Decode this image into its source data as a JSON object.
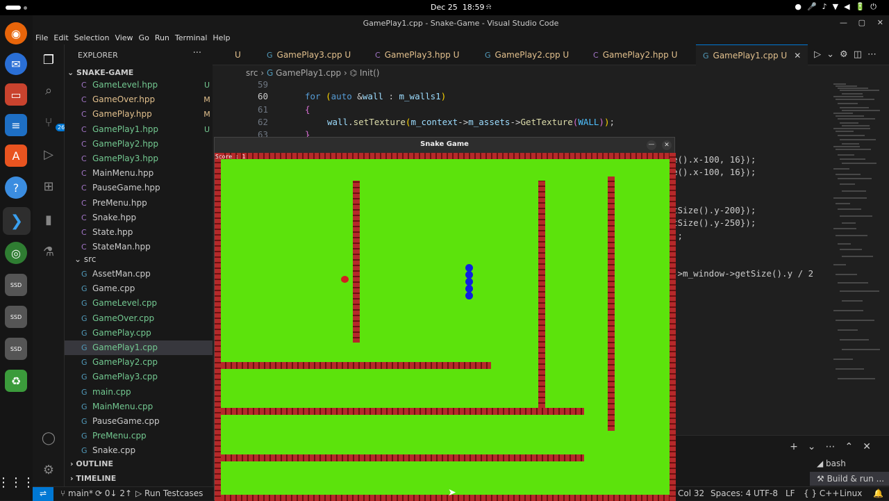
{
  "os": {
    "date": "Dec 25",
    "time": "18:59"
  },
  "window": {
    "title": "GamePlay1.cpp - Snake-Game - Visual Studio Code"
  },
  "menu": [
    "File",
    "Edit",
    "Selection",
    "View",
    "Go",
    "Run",
    "Terminal",
    "Help"
  ],
  "activity": {
    "scm_badge": "26"
  },
  "sidebar": {
    "header": "EXPLORER",
    "more": "···",
    "project": "SNAKE-GAME",
    "folder_src": "src",
    "outline": "OUTLINE",
    "timeline": "TIMELINE",
    "headers": [
      {
        "name": "GameLevel.hpp",
        "status": "U",
        "color": "#73c991"
      },
      {
        "name": "GameOver.hpp",
        "status": "M",
        "color": "#e2c08d"
      },
      {
        "name": "GamePlay.hpp",
        "status": "M",
        "color": "#e2c08d"
      },
      {
        "name": "GamePlay1.hpp",
        "status": "U",
        "color": "#73c991"
      },
      {
        "name": "GamePlay2.hpp",
        "status": "",
        "color": "#73c991"
      },
      {
        "name": "GamePlay3.hpp",
        "status": "",
        "color": "#73c991"
      },
      {
        "name": "MainMenu.hpp",
        "status": "",
        "color": "#cccccc"
      },
      {
        "name": "PauseGame.hpp",
        "status": "",
        "color": "#cccccc"
      },
      {
        "name": "PreMenu.hpp",
        "status": "",
        "color": "#cccccc"
      },
      {
        "name": "Snake.hpp",
        "status": "",
        "color": "#cccccc"
      },
      {
        "name": "State.hpp",
        "status": "",
        "color": "#cccccc"
      },
      {
        "name": "StateMan.hpp",
        "status": "",
        "color": "#cccccc"
      }
    ],
    "sources": [
      {
        "name": "AssetMan.cpp",
        "color": "#cccccc"
      },
      {
        "name": "Game.cpp",
        "color": "#cccccc"
      },
      {
        "name": "GameLevel.cpp",
        "color": "#73c991"
      },
      {
        "name": "GameOver.cpp",
        "color": "#73c991"
      },
      {
        "name": "GamePlay.cpp",
        "color": "#73c991"
      },
      {
        "name": "GamePlay1.cpp",
        "color": "#73c991"
      },
      {
        "name": "GamePlay2.cpp",
        "color": "#73c991"
      },
      {
        "name": "GamePlay3.cpp",
        "color": "#73c991"
      },
      {
        "name": "main.cpp",
        "color": "#73c991"
      },
      {
        "name": "MainMenu.cpp",
        "color": "#73c991"
      },
      {
        "name": "PauseGame.cpp",
        "color": "#cccccc"
      },
      {
        "name": "PreMenu.cpp",
        "color": "#73c991"
      },
      {
        "name": "Snake.cpp",
        "color": "#cccccc"
      }
    ]
  },
  "tabs": [
    {
      "label": "GamePlay3.cpp",
      "status": "U"
    },
    {
      "label": "GamePlay3.hpp",
      "status": "U"
    },
    {
      "label": "GamePlay2.cpp",
      "status": "U"
    },
    {
      "label": "GamePlay2.hpp",
      "status": "U"
    },
    {
      "label": "GamePlay1.cpp",
      "status": "U"
    }
  ],
  "tab_partial": "U",
  "breadcrumb": {
    "folder": "src",
    "file": "GamePlay1.cpp",
    "symbol": "Init()"
  },
  "editor": {
    "line_numbers": [
      "59",
      "60",
      "61",
      "62",
      "63"
    ],
    "right_fragments": [
      "e().x-100, 16});",
      "e().x-100, 16});",
      "tSize().y-200});",
      "tSize().y-250});",
      ");",
      "->m_window->getSize().y / 2"
    ]
  },
  "game": {
    "title": "Snake Game",
    "score_label": "Score : 1"
  },
  "terminal": {
    "bash": "bash",
    "build": "Build & run ..."
  },
  "status": {
    "branch": "main*",
    "sync": "0↓ 2↑",
    "run": "Run Testcases",
    "position": "Col 32",
    "spaces": "Spaces: 4",
    "encoding": "UTF-8",
    "eol": "LF",
    "language": "C++",
    "os": "Linux"
  }
}
